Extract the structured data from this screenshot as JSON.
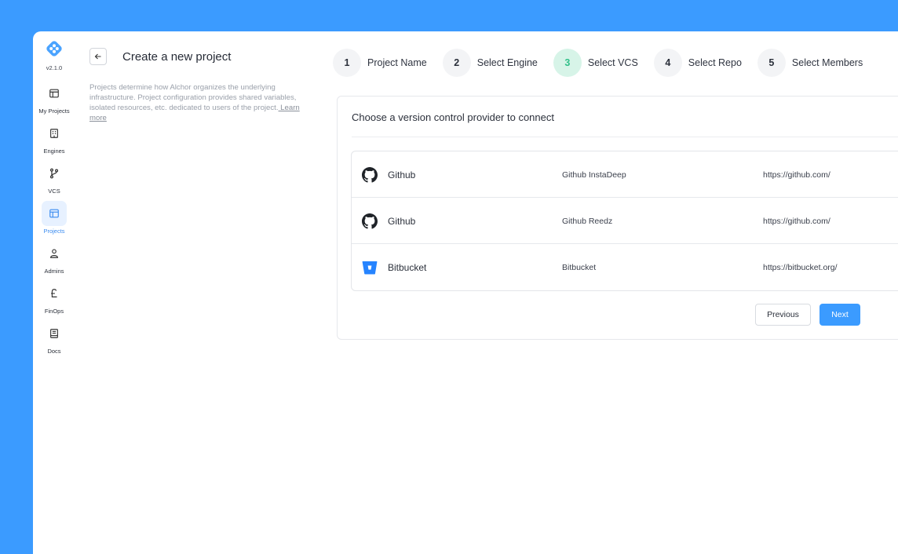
{
  "app": {
    "version": "v2.1.0",
    "accent": "#3b9bff"
  },
  "sidebar": {
    "items": [
      {
        "label": "My Projects",
        "icon": "layout-icon",
        "active": false
      },
      {
        "label": "Engines",
        "icon": "building-icon",
        "active": false
      },
      {
        "label": "VCS",
        "icon": "git-branch-icon",
        "active": false
      },
      {
        "label": "Projects",
        "icon": "layout-icon",
        "active": true
      },
      {
        "label": "Admins",
        "icon": "users-icon",
        "active": false
      },
      {
        "label": "FinOps",
        "icon": "pound-icon",
        "active": false
      },
      {
        "label": "Docs",
        "icon": "book-icon",
        "active": false
      }
    ]
  },
  "header": {
    "title": "Create a new project",
    "description": "Projects determine how Alchor organizes the underlying infrastructure.  Project configuration provides shared variables, isolated resources,  etc. dedicated to users of the project.",
    "learn_more": " Learn more"
  },
  "stepper": {
    "steps": [
      {
        "num": "1",
        "label": "Project Name"
      },
      {
        "num": "2",
        "label": "Select Engine"
      },
      {
        "num": "3",
        "label": "Select VCS"
      },
      {
        "num": "4",
        "label": "Select Repo"
      },
      {
        "num": "5",
        "label": "Select Members"
      }
    ],
    "active_step": "3"
  },
  "card": {
    "title": "Choose a version control provider to connect",
    "providers": [
      {
        "icon": "github-icon",
        "name": "Github",
        "label": "Github InstaDeep",
        "url": "https://github.com/"
      },
      {
        "icon": "github-icon",
        "name": "Github",
        "label": "Github Reedz",
        "url": "https://github.com/"
      },
      {
        "icon": "bitbucket-icon",
        "name": "Bitbucket",
        "label": "Bitbucket",
        "url": "https://bitbucket.org/"
      }
    ],
    "previous_label": "Previous",
    "next_label": "Next"
  }
}
